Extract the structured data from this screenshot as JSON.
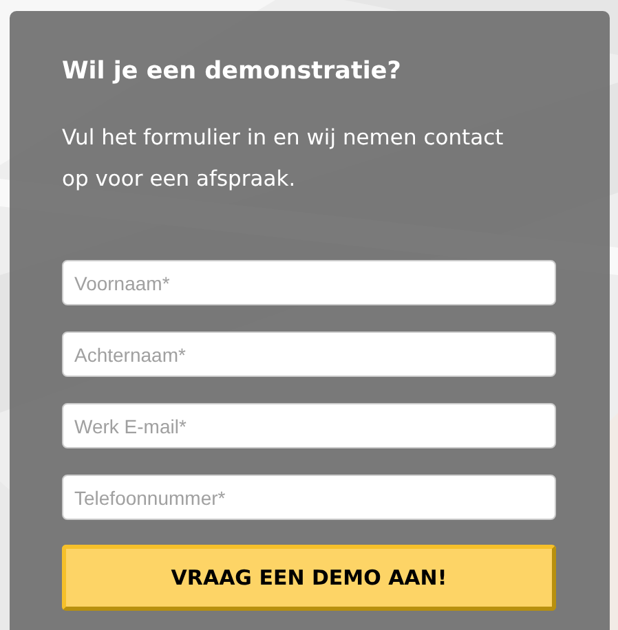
{
  "form": {
    "title": "Wil je een demonstratie?",
    "intro": "Vul het formulier in en wij nemen contact op voor een afspraak.",
    "fields": [
      {
        "placeholder": "Voornaam*"
      },
      {
        "placeholder": "Achternaam*"
      },
      {
        "placeholder": "Werk E-mail*"
      },
      {
        "placeholder": "Telefoonnummer*"
      }
    ],
    "submit": "VRAAG EEN DEMO AAN!"
  }
}
